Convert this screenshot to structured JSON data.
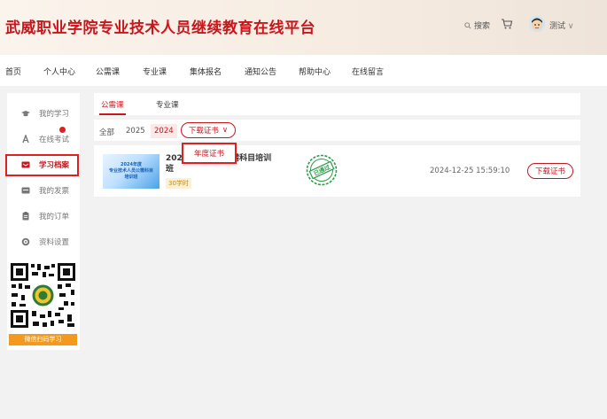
{
  "header": {
    "site_title": "武威职业学院专业技术人员继续教育在线平台",
    "search_label": "搜索",
    "user_name": "测试"
  },
  "nav": {
    "items": [
      "首页",
      "个人中心",
      "公需课",
      "专业课",
      "集体报名",
      "通知公告",
      "帮助中心",
      "在线留言"
    ]
  },
  "sidebar": {
    "items": [
      {
        "label": "我的学习",
        "icon": "graduation-cap-icon"
      },
      {
        "label": "在线考试",
        "icon": "exam-icon"
      },
      {
        "label": "学习档案",
        "icon": "archive-icon",
        "active": true
      },
      {
        "label": "我的发票",
        "icon": "invoice-icon"
      },
      {
        "label": "我的订单",
        "icon": "order-icon"
      },
      {
        "label": "资料设置",
        "icon": "gear-icon"
      }
    ],
    "qr_caption": "微信扫码学习"
  },
  "main": {
    "tabs": [
      "公需课",
      "专业课"
    ],
    "filters": [
      "全部",
      "2025",
      "2024"
    ],
    "download_select": "下载证书",
    "dropdown_option": "年度证书",
    "course": {
      "thumb_lines": [
        "2024年度",
        "专业技术人员公需科目",
        "培训班"
      ],
      "title_line1": "2024",
      "title_line1b": "公需科目培训",
      "title_line2": "班",
      "hours": "30学时",
      "stamp_text": "已通过",
      "date": "2024-12-25 15:59:10",
      "download_label": "下载证书"
    }
  },
  "colors": {
    "brand_red": "#c8161d",
    "highlight_red": "#e02020",
    "qr_orange": "#f39a1e"
  }
}
